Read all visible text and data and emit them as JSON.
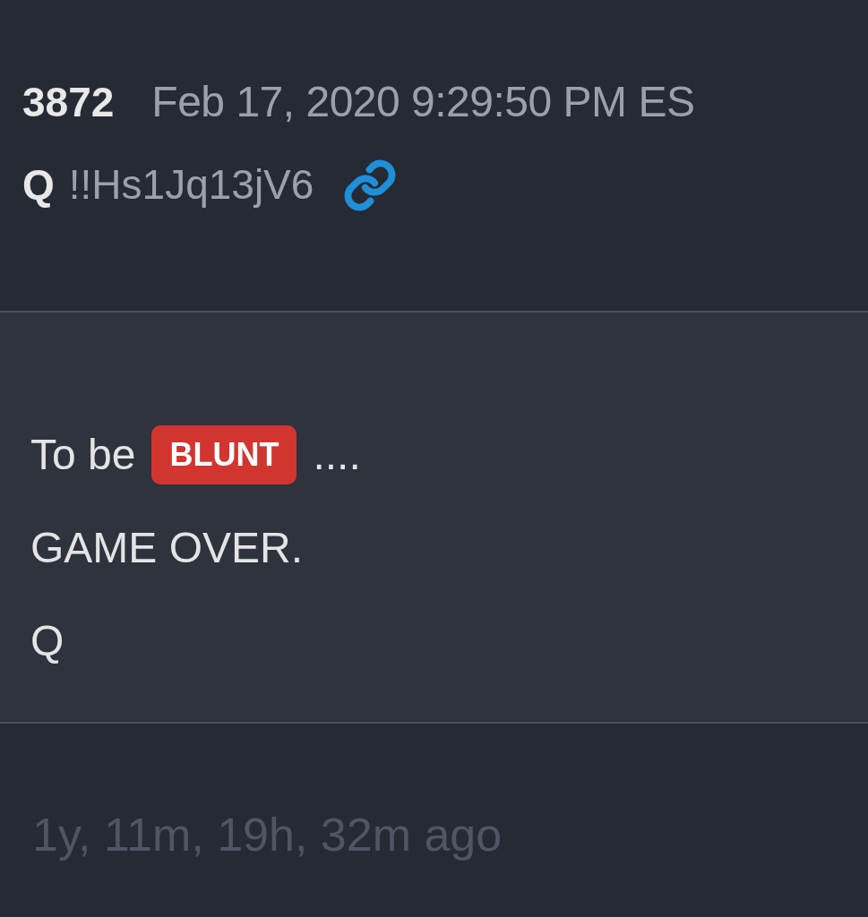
{
  "post": {
    "number": "3872",
    "timestamp": "Feb 17, 2020 9:29:50 PM ES",
    "author": "Q",
    "tripcode": "!!Hs1Jq13jV6"
  },
  "body": [
    {
      "segments": [
        {
          "kind": "text",
          "text": "To be"
        },
        {
          "kind": "badge",
          "text": "BLUNT"
        },
        {
          "kind": "text",
          "text": "...."
        }
      ]
    },
    {
      "segments": [
        {
          "kind": "text",
          "text": "GAME OVER."
        }
      ]
    },
    {
      "segments": [
        {
          "kind": "text",
          "text": "Q"
        }
      ]
    }
  ],
  "footer": {
    "age": "1y, 11m, 19h, 32m ago"
  }
}
